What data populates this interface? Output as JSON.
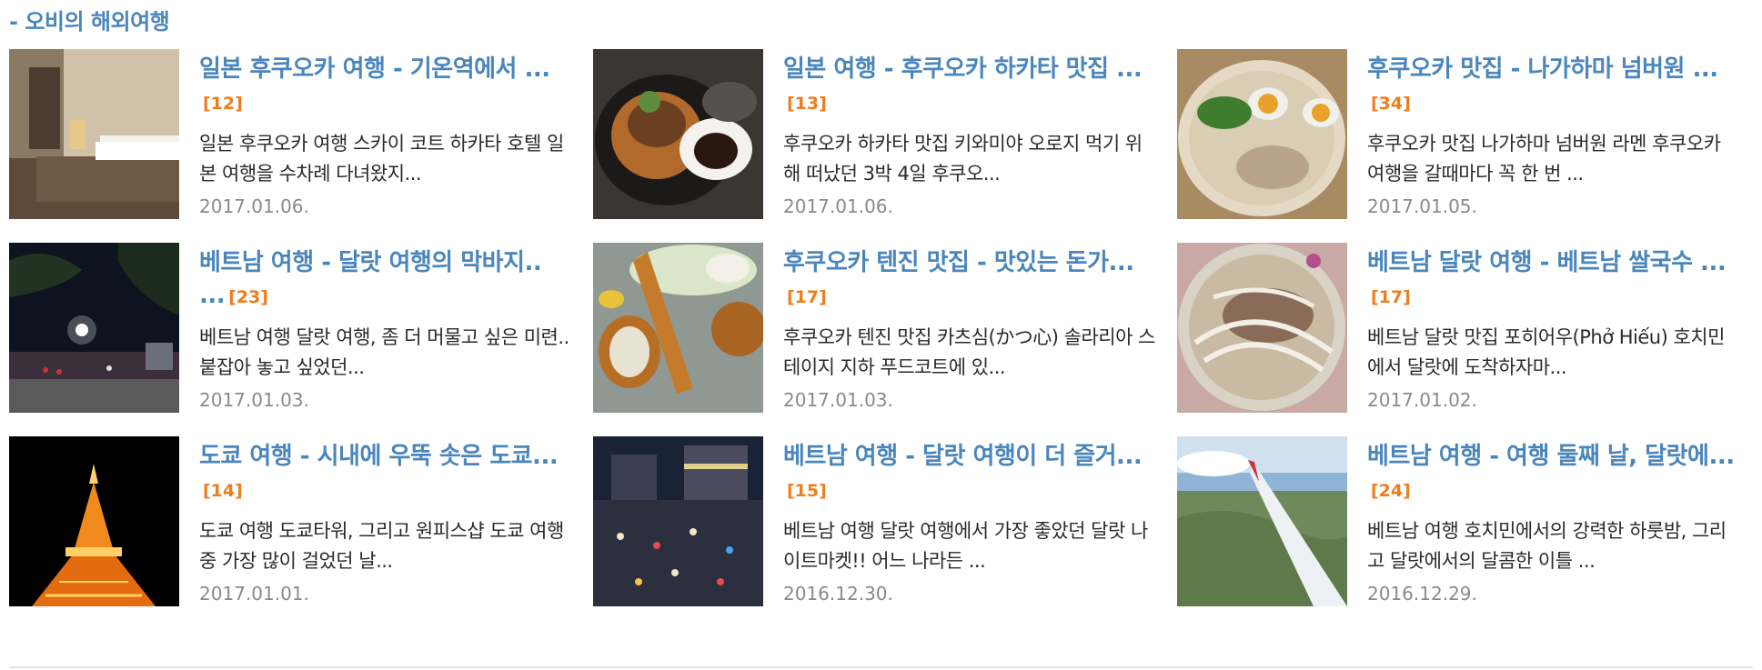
{
  "section": {
    "title": "- 오비의 해외여행"
  },
  "posts": [
    {
      "title": "일본 후쿠오카 여행 - 기온역에서 ...",
      "count": "[12]",
      "excerpt": "일본 후쿠오카 여행 스카이 코트 하카타 호텔 일본 여행을 수차례 다녀왔지...",
      "date": "2017.01.06.",
      "image": "hotel-room"
    },
    {
      "title": "일본 여행 - 후쿠오카 하카타 맛집 ...",
      "count": "[13]",
      "excerpt": "후쿠오카 하카타 맛집 키와미야 오로지 먹기 위해 떠났던 3박 4일 후쿠오...",
      "date": "2017.01.06.",
      "image": "hamburg-steak"
    },
    {
      "title": "후쿠오카 맛집 - 나가하마 넘버원 ...",
      "count": "[34]",
      "excerpt": "후쿠오카 맛집 나가하마 넘버원 라멘 후쿠오카 여행을 갈때마다 꼭 한 번 ...",
      "date": "2017.01.05.",
      "image": "ramen-bowl"
    },
    {
      "title": "베트남 여행 - 달랏 여행의 막바지.. ...",
      "count": "[23]",
      "excerpt": "베트남 여행 달랏 여행, 좀 더 머물고 싶은 미련.. 붙잡아 놓고 싶었던...",
      "date": "2017.01.03.",
      "image": "night-square"
    },
    {
      "title": "후쿠오카 텐진 맛집 - 맛있는 돈가...",
      "count": "[17]",
      "excerpt": "후쿠오카 텐진 맛집 카츠심(かつ心) 솔라리아 스테이지 지하 푸드코트에 있...",
      "date": "2017.01.03.",
      "image": "tonkatsu-plate"
    },
    {
      "title": "베트남 달랏 여행 - 베트남 쌀국수 ...",
      "count": "[17]",
      "excerpt": "베트남 달랏 맛집 포히어우(Phở Hiếu) 호치민에서 달랏에 도착하자마...",
      "date": "2017.01.02.",
      "image": "pho-bowl"
    },
    {
      "title": "도쿄 여행 - 시내에 우뚝 솟은 도쿄...",
      "count": "[14]",
      "excerpt": "도쿄 여행 도쿄타워, 그리고 원피스샵 도쿄 여행 중 가장 많이 걸었던 날...",
      "date": "2017.01.01.",
      "image": "tokyo-tower"
    },
    {
      "title": "베트남 여행 - 달랏 여행이 더 즐거...",
      "count": "[15]",
      "excerpt": "베트남 여행 달랏 여행에서 가장 좋았던 달랏 나이트마켓!! 어느 나라든 ...",
      "date": "2016.12.30.",
      "image": "night-market"
    },
    {
      "title": "베트남 여행 - 여행 둘째 날, 달랏에...",
      "count": "[24]",
      "excerpt": "베트남 여행 호치민에서의 강력한 하룻밤, 그리고 달랏에서의 달콤한 이틀 ...",
      "date": "2016.12.29.",
      "image": "airplane-wing"
    }
  ]
}
